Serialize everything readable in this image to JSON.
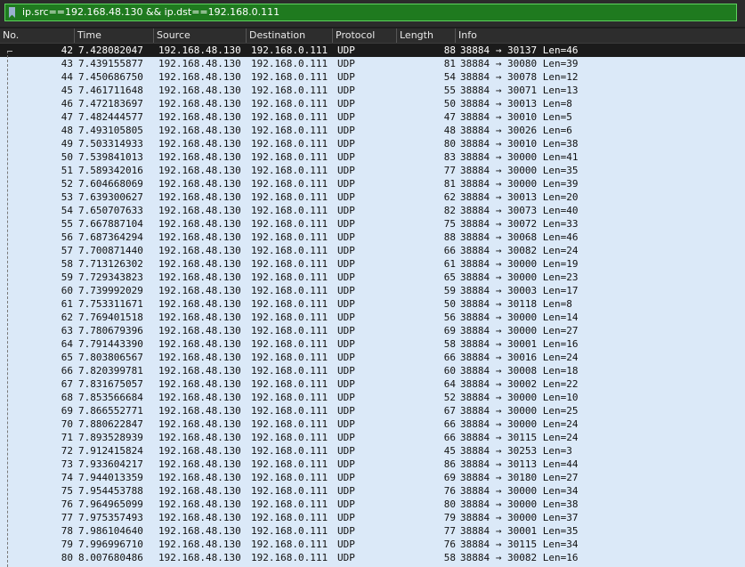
{
  "filter": {
    "text": "ip.src==192.168.48.130 && ip.dst==192.168.0.111"
  },
  "columns": {
    "no": "No.",
    "time": "Time",
    "source": "Source",
    "destination": "Destination",
    "protocol": "Protocol",
    "length": "Length",
    "info": "Info"
  },
  "colors": {
    "selected_row": "#1b1b1b",
    "row_bg": "#dbe9f8",
    "filter_ok": "#1f7a1f"
  },
  "packets": [
    {
      "no": "42",
      "time": "7.428082047",
      "src": "192.168.48.130",
      "dst": "192.168.0.111",
      "proto": "UDP",
      "len": "88",
      "info": "38884 → 30137 Len=46",
      "selected": true
    },
    {
      "no": "43",
      "time": "7.439155877",
      "src": "192.168.48.130",
      "dst": "192.168.0.111",
      "proto": "UDP",
      "len": "81",
      "info": "38884 → 30080 Len=39"
    },
    {
      "no": "44",
      "time": "7.450686750",
      "src": "192.168.48.130",
      "dst": "192.168.0.111",
      "proto": "UDP",
      "len": "54",
      "info": "38884 → 30078 Len=12"
    },
    {
      "no": "45",
      "time": "7.461711648",
      "src": "192.168.48.130",
      "dst": "192.168.0.111",
      "proto": "UDP",
      "len": "55",
      "info": "38884 → 30071 Len=13"
    },
    {
      "no": "46",
      "time": "7.472183697",
      "src": "192.168.48.130",
      "dst": "192.168.0.111",
      "proto": "UDP",
      "len": "50",
      "info": "38884 → 30013 Len=8"
    },
    {
      "no": "47",
      "time": "7.482444577",
      "src": "192.168.48.130",
      "dst": "192.168.0.111",
      "proto": "UDP",
      "len": "47",
      "info": "38884 → 30010 Len=5"
    },
    {
      "no": "48",
      "time": "7.493105805",
      "src": "192.168.48.130",
      "dst": "192.168.0.111",
      "proto": "UDP",
      "len": "48",
      "info": "38884 → 30026 Len=6"
    },
    {
      "no": "49",
      "time": "7.503314933",
      "src": "192.168.48.130",
      "dst": "192.168.0.111",
      "proto": "UDP",
      "len": "80",
      "info": "38884 → 30010 Len=38"
    },
    {
      "no": "50",
      "time": "7.539841013",
      "src": "192.168.48.130",
      "dst": "192.168.0.111",
      "proto": "UDP",
      "len": "83",
      "info": "38884 → 30000 Len=41"
    },
    {
      "no": "51",
      "time": "7.589342016",
      "src": "192.168.48.130",
      "dst": "192.168.0.111",
      "proto": "UDP",
      "len": "77",
      "info": "38884 → 30000 Len=35"
    },
    {
      "no": "52",
      "time": "7.604668069",
      "src": "192.168.48.130",
      "dst": "192.168.0.111",
      "proto": "UDP",
      "len": "81",
      "info": "38884 → 30000 Len=39"
    },
    {
      "no": "53",
      "time": "7.639300627",
      "src": "192.168.48.130",
      "dst": "192.168.0.111",
      "proto": "UDP",
      "len": "62",
      "info": "38884 → 30013 Len=20"
    },
    {
      "no": "54",
      "time": "7.650707633",
      "src": "192.168.48.130",
      "dst": "192.168.0.111",
      "proto": "UDP",
      "len": "82",
      "info": "38884 → 30073 Len=40"
    },
    {
      "no": "55",
      "time": "7.667887104",
      "src": "192.168.48.130",
      "dst": "192.168.0.111",
      "proto": "UDP",
      "len": "75",
      "info": "38884 → 30072 Len=33"
    },
    {
      "no": "56",
      "time": "7.687364294",
      "src": "192.168.48.130",
      "dst": "192.168.0.111",
      "proto": "UDP",
      "len": "88",
      "info": "38884 → 30068 Len=46"
    },
    {
      "no": "57",
      "time": "7.700871440",
      "src": "192.168.48.130",
      "dst": "192.168.0.111",
      "proto": "UDP",
      "len": "66",
      "info": "38884 → 30082 Len=24"
    },
    {
      "no": "58",
      "time": "7.713126302",
      "src": "192.168.48.130",
      "dst": "192.168.0.111",
      "proto": "UDP",
      "len": "61",
      "info": "38884 → 30000 Len=19"
    },
    {
      "no": "59",
      "time": "7.729343823",
      "src": "192.168.48.130",
      "dst": "192.168.0.111",
      "proto": "UDP",
      "len": "65",
      "info": "38884 → 30000 Len=23"
    },
    {
      "no": "60",
      "time": "7.739992029",
      "src": "192.168.48.130",
      "dst": "192.168.0.111",
      "proto": "UDP",
      "len": "59",
      "info": "38884 → 30003 Len=17"
    },
    {
      "no": "61",
      "time": "7.753311671",
      "src": "192.168.48.130",
      "dst": "192.168.0.111",
      "proto": "UDP",
      "len": "50",
      "info": "38884 → 30118 Len=8"
    },
    {
      "no": "62",
      "time": "7.769401518",
      "src": "192.168.48.130",
      "dst": "192.168.0.111",
      "proto": "UDP",
      "len": "56",
      "info": "38884 → 30000 Len=14"
    },
    {
      "no": "63",
      "time": "7.780679396",
      "src": "192.168.48.130",
      "dst": "192.168.0.111",
      "proto": "UDP",
      "len": "69",
      "info": "38884 → 30000 Len=27"
    },
    {
      "no": "64",
      "time": "7.791443390",
      "src": "192.168.48.130",
      "dst": "192.168.0.111",
      "proto": "UDP",
      "len": "58",
      "info": "38884 → 30001 Len=16"
    },
    {
      "no": "65",
      "time": "7.803806567",
      "src": "192.168.48.130",
      "dst": "192.168.0.111",
      "proto": "UDP",
      "len": "66",
      "info": "38884 → 30016 Len=24"
    },
    {
      "no": "66",
      "time": "7.820399781",
      "src": "192.168.48.130",
      "dst": "192.168.0.111",
      "proto": "UDP",
      "len": "60",
      "info": "38884 → 30008 Len=18"
    },
    {
      "no": "67",
      "time": "7.831675057",
      "src": "192.168.48.130",
      "dst": "192.168.0.111",
      "proto": "UDP",
      "len": "64",
      "info": "38884 → 30002 Len=22"
    },
    {
      "no": "68",
      "time": "7.853566684",
      "src": "192.168.48.130",
      "dst": "192.168.0.111",
      "proto": "UDP",
      "len": "52",
      "info": "38884 → 30000 Len=10"
    },
    {
      "no": "69",
      "time": "7.866552771",
      "src": "192.168.48.130",
      "dst": "192.168.0.111",
      "proto": "UDP",
      "len": "67",
      "info": "38884 → 30000 Len=25"
    },
    {
      "no": "70",
      "time": "7.880622847",
      "src": "192.168.48.130",
      "dst": "192.168.0.111",
      "proto": "UDP",
      "len": "66",
      "info": "38884 → 30000 Len=24"
    },
    {
      "no": "71",
      "time": "7.893528939",
      "src": "192.168.48.130",
      "dst": "192.168.0.111",
      "proto": "UDP",
      "len": "66",
      "info": "38884 → 30115 Len=24"
    },
    {
      "no": "72",
      "time": "7.912415824",
      "src": "192.168.48.130",
      "dst": "192.168.0.111",
      "proto": "UDP",
      "len": "45",
      "info": "38884 → 30253 Len=3"
    },
    {
      "no": "73",
      "time": "7.933604217",
      "src": "192.168.48.130",
      "dst": "192.168.0.111",
      "proto": "UDP",
      "len": "86",
      "info": "38884 → 30113 Len=44"
    },
    {
      "no": "74",
      "time": "7.944013359",
      "src": "192.168.48.130",
      "dst": "192.168.0.111",
      "proto": "UDP",
      "len": "69",
      "info": "38884 → 30180 Len=27"
    },
    {
      "no": "75",
      "time": "7.954453788",
      "src": "192.168.48.130",
      "dst": "192.168.0.111",
      "proto": "UDP",
      "len": "76",
      "info": "38884 → 30000 Len=34"
    },
    {
      "no": "76",
      "time": "7.964965099",
      "src": "192.168.48.130",
      "dst": "192.168.0.111",
      "proto": "UDP",
      "len": "80",
      "info": "38884 → 30000 Len=38"
    },
    {
      "no": "77",
      "time": "7.975357493",
      "src": "192.168.48.130",
      "dst": "192.168.0.111",
      "proto": "UDP",
      "len": "79",
      "info": "38884 → 30000 Len=37"
    },
    {
      "no": "78",
      "time": "7.986104640",
      "src": "192.168.48.130",
      "dst": "192.168.0.111",
      "proto": "UDP",
      "len": "77",
      "info": "38884 → 30001 Len=35"
    },
    {
      "no": "79",
      "time": "7.996996710",
      "src": "192.168.48.130",
      "dst": "192.168.0.111",
      "proto": "UDP",
      "len": "76",
      "info": "38884 → 30115 Len=34"
    },
    {
      "no": "80",
      "time": "8.007680486",
      "src": "192.168.48.130",
      "dst": "192.168.0.111",
      "proto": "UDP",
      "len": "58",
      "info": "38884 → 30082 Len=16"
    }
  ]
}
